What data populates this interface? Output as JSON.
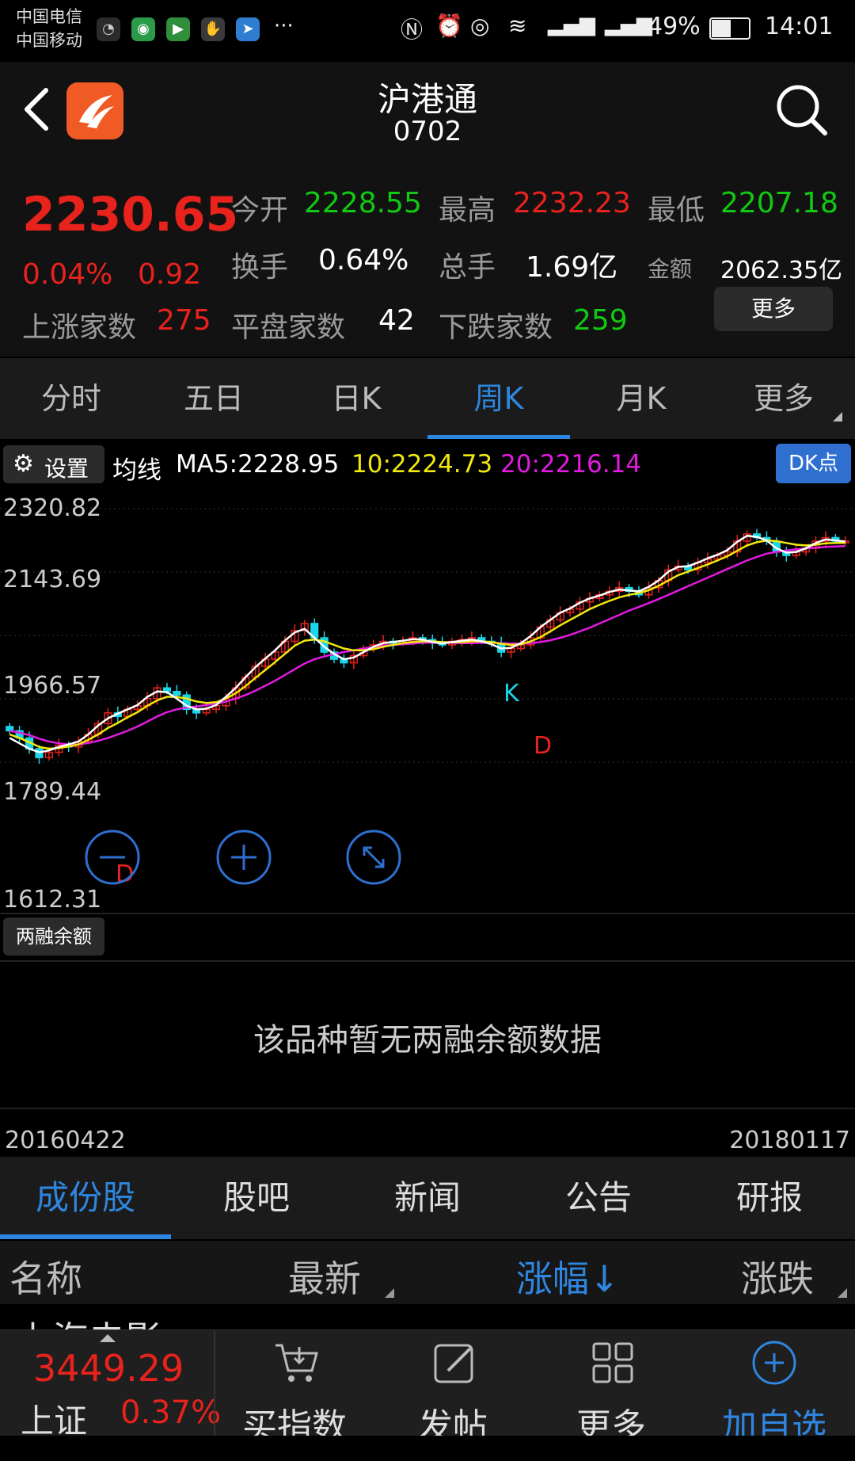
{
  "status_bar": {
    "carrier1": "中国电信",
    "carrier2": "中国移动",
    "battery": "49%",
    "time": "14:01",
    "ellipsis": "···"
  },
  "header": {
    "title": "沪港通",
    "code": "0702"
  },
  "quote": {
    "price": "2230.65",
    "change_pct": "0.04%",
    "change": "0.92",
    "up_label": "上涨家数",
    "up_count": "275",
    "open_label": "今开",
    "open": "2228.55",
    "high_label": "最高",
    "high": "2232.23",
    "low_label": "最低",
    "low": "2207.18",
    "turnover_label": "换手",
    "turnover": "0.64%",
    "volume_label": "总手",
    "volume": "1.69亿",
    "amount_label": "金额",
    "amount": "2062.35亿",
    "flat_label": "平盘家数",
    "flat_count": "42",
    "down_label": "下跌家数",
    "down_count": "259",
    "more": "更多"
  },
  "period_tabs": [
    "分时",
    "五日",
    "日K",
    "周K",
    "月K",
    "更多"
  ],
  "ma_row": {
    "settings": "设置",
    "ma_label": "均线",
    "ma5": "MA5:2228.95",
    "ma10": "10:2224.73",
    "ma20": "20:2216.14",
    "dk": "DK点"
  },
  "chart_data": {
    "type": "candlestick",
    "y_ticks": [
      "2320.82",
      "2143.69",
      "1966.57",
      "1789.44",
      "1612.31"
    ],
    "ylim": [
      1612.31,
      2320.82
    ],
    "x_start": "20160422",
    "x_end": "20180117",
    "markers": [
      "K",
      "D",
      "D"
    ],
    "series": [
      {
        "name": "MA5",
        "color": "#ffffff"
      },
      {
        "name": "10",
        "color": "#f2e90c"
      },
      {
        "name": "20",
        "color": "#e21be0"
      }
    ],
    "closes": [
      1700,
      1680,
      1650,
      1625,
      1640,
      1660,
      1655,
      1670,
      1690,
      1720,
      1750,
      1740,
      1760,
      1770,
      1790,
      1820,
      1810,
      1800,
      1760,
      1750,
      1760,
      1770,
      1790,
      1820,
      1850,
      1880,
      1900,
      1920,
      1950,
      1980,
      2000,
      1960,
      1920,
      1900,
      1890,
      1910,
      1930,
      1940,
      1950,
      1945,
      1950,
      1960,
      1955,
      1945,
      1940,
      1950,
      1955,
      1960,
      1950,
      1945,
      1920,
      1930,
      1940,
      1960,
      1990,
      2010,
      2030,
      2040,
      2060,
      2070,
      2080,
      2090,
      2100,
      2090,
      2080,
      2100,
      2120,
      2150,
      2160,
      2150,
      2170,
      2180,
      2190,
      2200,
      2230,
      2250,
      2240,
      2230,
      2200,
      2190,
      2200,
      2210,
      2230,
      2240,
      2230,
      2230
    ],
    "ma5": [
      1680,
      1665,
      1650,
      1640,
      1645,
      1655,
      1662,
      1670,
      1690,
      1715,
      1735,
      1748,
      1760,
      1772,
      1795,
      1810,
      1808,
      1790,
      1770,
      1760,
      1762,
      1772,
      1795,
      1820,
      1850,
      1878,
      1902,
      1925,
      1952,
      1975,
      1985,
      1960,
      1935,
      1915,
      1900,
      1905,
      1920,
      1935,
      1945,
      1948,
      1952,
      1956,
      1955,
      1948,
      1944,
      1948,
      1952,
      1955,
      1950,
      1942,
      1930,
      1932,
      1945,
      1965,
      1990,
      2010,
      2030,
      2042,
      2058,
      2070,
      2078,
      2088,
      2095,
      2092,
      2090,
      2102,
      2120,
      2145,
      2158,
      2160,
      2170,
      2182,
      2192,
      2205,
      2228,
      2245,
      2242,
      2232,
      2210,
      2198,
      2200,
      2210,
      2225,
      2235,
      2232,
      2229
    ],
    "ma10": [
      1690,
      1680,
      1668,
      1655,
      1650,
      1652,
      1656,
      1662,
      1675,
      1690,
      1708,
      1722,
      1738,
      1752,
      1770,
      1785,
      1795,
      1795,
      1790,
      1782,
      1778,
      1780,
      1790,
      1805,
      1825,
      1848,
      1870,
      1892,
      1915,
      1938,
      1952,
      1955,
      1950,
      1940,
      1930,
      1925,
      1925,
      1928,
      1935,
      1940,
      1945,
      1948,
      1950,
      1950,
      1948,
      1947,
      1948,
      1950,
      1950,
      1948,
      1943,
      1940,
      1942,
      1950,
      1962,
      1978,
      1995,
      2010,
      2025,
      2040,
      2052,
      2063,
      2073,
      2080,
      2085,
      2093,
      2105,
      2120,
      2135,
      2145,
      2155,
      2165,
      2176,
      2188,
      2203,
      2218,
      2227,
      2232,
      2230,
      2225,
      2220,
      2218,
      2220,
      2224,
      2225,
      2225
    ],
    "ma20": [
      1700,
      1695,
      1688,
      1678,
      1670,
      1665,
      1662,
      1662,
      1666,
      1672,
      1680,
      1690,
      1700,
      1712,
      1726,
      1740,
      1752,
      1760,
      1765,
      1768,
      1772,
      1776,
      1782,
      1790,
      1800,
      1812,
      1826,
      1840,
      1856,
      1872,
      1888,
      1900,
      1908,
      1914,
      1920,
      1925,
      1930,
      1934,
      1938,
      1940,
      1942,
      1944,
      1946,
      1946,
      1946,
      1946,
      1945,
      1945,
      1946,
      1946,
      1945,
      1944,
      1944,
      1945,
      1948,
      1953,
      1960,
      1968,
      1978,
      1988,
      2000,
      2012,
      2024,
      2036,
      2046,
      2057,
      2068,
      2080,
      2092,
      2104,
      2116,
      2128,
      2140,
      2152,
      2164,
      2176,
      2186,
      2195,
      2200,
      2204,
      2207,
      2210,
      2212,
      2214,
      2215,
      2216
    ]
  },
  "margin": {
    "button": "两融余额",
    "empty_text": "该品种暂无两融余额数据"
  },
  "content_tabs": [
    "成份股",
    "股吧",
    "新闻",
    "公告",
    "研报"
  ],
  "columns": {
    "name": "名称",
    "latest": "最新",
    "change_pct": "涨幅↓",
    "change": "涨跌"
  },
  "partial_row": "上海电影",
  "bottom": {
    "index_value": "3449.29",
    "index_name": "上证",
    "index_pct": "0.37%",
    "nav": [
      "买指数",
      "发帖",
      "更多",
      "加自选"
    ]
  }
}
